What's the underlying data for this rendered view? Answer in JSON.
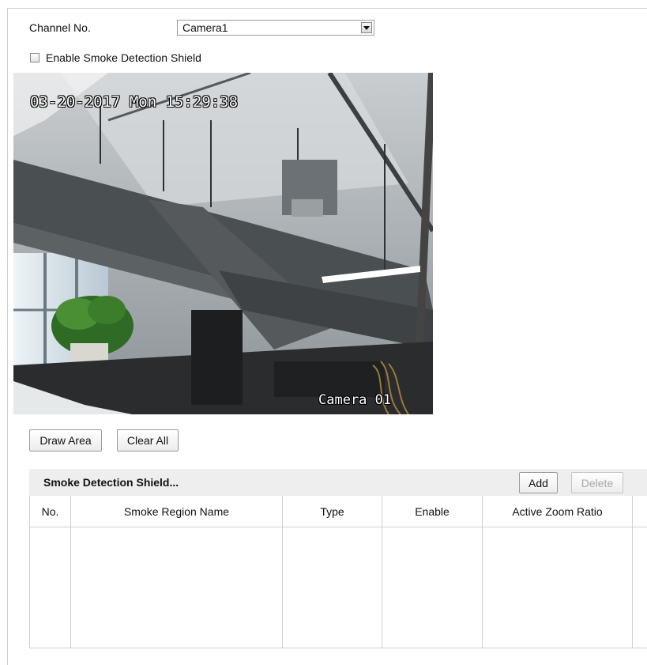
{
  "form": {
    "channel_label": "Channel No.",
    "channel_value": "Camera1",
    "enable_shield_label": "Enable Smoke Detection Shield",
    "enable_shield_checked": false
  },
  "video": {
    "timestamp_osd": "03-20-2017 Mon 15:29:38",
    "camera_osd": "Camera 01"
  },
  "buttons": {
    "draw_area": "Draw Area",
    "clear_all": "Clear All"
  },
  "shield_panel": {
    "title": "Smoke Detection Shield...",
    "add_label": "Add",
    "delete_label": "Delete",
    "columns": [
      "No.",
      "Smoke Region Name",
      "Type",
      "Enable",
      "Active Zoom Ratio"
    ],
    "rows": []
  },
  "icons": {
    "dropdown": "chevron-down-icon"
  }
}
